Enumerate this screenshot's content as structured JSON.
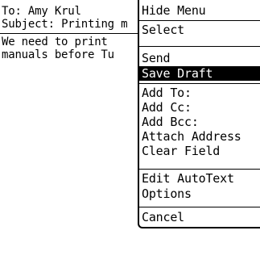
{
  "compose": {
    "to_label": "To:",
    "to_value": "Amy Krul",
    "subject_label": "Subject:",
    "subject_value": "Printing m",
    "body_lines": [
      "We need to print",
      "manuals before Tu"
    ]
  },
  "menu": {
    "items": [
      {
        "label": "Hide Menu"
      },
      {
        "label": "Select"
      },
      {
        "label": "Send"
      },
      {
        "label": "Save Draft",
        "selected": true
      },
      {
        "label": "Add To:"
      },
      {
        "label": "Add Cc:"
      },
      {
        "label": "Add Bcc:"
      },
      {
        "label": "Attach Address"
      },
      {
        "label": "Clear Field"
      },
      {
        "label": "Edit AutoText"
      },
      {
        "label": "Options"
      },
      {
        "label": "Cancel"
      }
    ]
  },
  "colors": {
    "background": "#ffffff",
    "foreground": "#000000",
    "highlight": "#000000"
  }
}
